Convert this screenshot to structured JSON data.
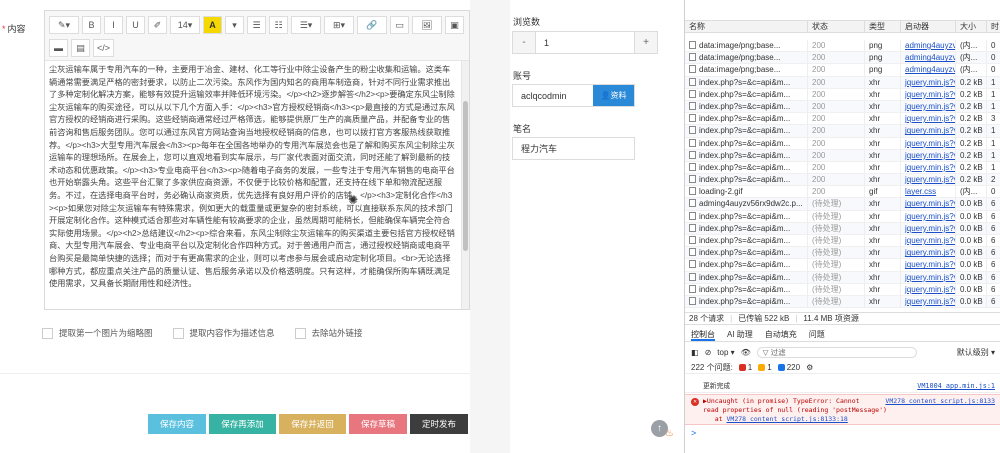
{
  "editor": {
    "field_label": "内容",
    "required_mark": "*",
    "toolbar_row1": [
      "✎▾",
      "B",
      "I",
      "U",
      "✐",
      "14▾",
      "A",
      "▾",
      "☰",
      "☷",
      "☰▾",
      "⊞▾",
      "🔗",
      "▭",
      "🖼",
      "▣"
    ],
    "toolbar_row2": [
      "▬",
      "▤",
      "</>"
    ],
    "content": "尘灰运输车属于专用汽车的一种，主要用于冶金、建材、化工等行业中除尘设备产生的粉尘收集和运输。这类车辆通常需要满足严格的密封要求，以防止二次污染。东风作为国内知名的商用车制造商，针对不同行业需求推出了多种定制化解决方案，能够有效提升运输效率并降低环境污染。</p><h2>逐步解答</h2><p>要确定东风尘制除尘灰运输车的购买途径，可以从以下几个方面入手：</p><h3>官方授权经销商</h3><p>最直接的方式是通过东风官方授权的经销商进行采购。这些经销商通常经过严格筛选，能够提供原厂生产的高质量产品，并配备专业的售前咨询和售后服务团队。您可以通过东风官方网站查询当地授权经销商的信息，也可以拨打官方客服热线获取推荐。</p><h3>大型专用汽车展会</h3><p>每年在全国各地举办的专用汽车展览会也是了解和购买东风尘制除尘灰运输车的理想场所。在展会上，您可以直观地看到实车展示，与厂家代表面对面交流，同时还能了解到最新的技术动态和优惠政策。</p><h3>专业电商平台</h3><p>随着电子商务的发展，一些专注于专用汽车销售的电商平台也开始崭露头角。这些平台汇聚了多家供应商资源，不仅便于比较价格和配置，还支持在线下单和物流配送服务。不过，在选择电商平台时，务必确认商家资质，优先选择有良好用户评价的店铺。</p><h3>定制化合作</h3><p>如果您对除尘灰运输车有特殊需求，例如更大的载重量或更复杂的密封系统，可以直接联系东风的技术部门开展定制化合作。这种模式适合那些对车辆性能有较高要求的企业，虽然周期可能稍长，但能确保车辆完全符合实际使用场景。</p><h2>总结建议</h2><p>综合来看，东风尘制除尘灰运输车的购买渠道主要包括官方授权经销商、大型专用汽车展会、专业电商平台以及定制化合作四种方式。对于普通用户而言，通过授权经销商或电商平台购买是最简单快捷的选择；而对于有更高需求的企业，则可以考虑参与展会或启动定制化项目。<br>无论选择哪种方式，都应重点关注产品的质量认证、售后服务承诺以及价格透明度。只有这样，才能确保所购车辆既满足使用需求，又具备长期耐用性和经济性。"
  },
  "checkboxes": [
    {
      "label": "提取第一个图片为缩略图"
    },
    {
      "label": "提取内容作为描述信息"
    },
    {
      "label": "去除站外链接"
    }
  ],
  "form": {
    "views_label": "浏览数",
    "views_value": "1",
    "minus": "-",
    "plus": "+",
    "account_label": "账号",
    "account_value": "aclqcodmin",
    "profile_button": "资料",
    "note_label": "笔名",
    "note_value": "程力汽车"
  },
  "actions": {
    "save": "保存内容",
    "save_add": "保存再添加",
    "save_back": "保存并返回",
    "save_draft": "保存草稿",
    "schedule": "定时发布"
  },
  "devtools": {
    "columns": [
      "名称",
      "状态",
      "类型",
      "启动器",
      "大小",
      "时"
    ],
    "rows": [
      {
        "name": "data:image/png;base...",
        "status": "200",
        "type": "png",
        "initiator": "adming4auyzv5",
        "size": "(内...",
        "time": "0"
      },
      {
        "name": "data:image/png;base...",
        "status": "200",
        "type": "png",
        "initiator": "adming4auyzv5",
        "size": "(内...",
        "time": "0"
      },
      {
        "name": "data:image/png;base...",
        "status": "200",
        "type": "png",
        "initiator": "adming4auyzv5",
        "size": "(内...",
        "time": "0"
      },
      {
        "name": "index.php?s=&c=api&m...",
        "status": "200",
        "type": "xhr",
        "initiator": "jquery.min.js?v",
        "size": "0.2 kB",
        "time": "1"
      },
      {
        "name": "index.php?s=&c=api&m...",
        "status": "200",
        "type": "xhr",
        "initiator": "jquery.min.js?v",
        "size": "0.2 kB",
        "time": "1"
      },
      {
        "name": "index.php?s=&c=api&m...",
        "status": "200",
        "type": "xhr",
        "initiator": "jquery.min.js?v",
        "size": "0.2 kB",
        "time": "1"
      },
      {
        "name": "index.php?s=&c=api&m...",
        "status": "200",
        "type": "xhr",
        "initiator": "jquery.min.js?v",
        "size": "0.2 kB",
        "time": "3"
      },
      {
        "name": "index.php?s=&c=api&m...",
        "status": "200",
        "type": "xhr",
        "initiator": "jquery.min.js?v",
        "size": "0.2 kB",
        "time": "1"
      },
      {
        "name": "index.php?s=&c=api&m...",
        "status": "200",
        "type": "xhr",
        "initiator": "jquery.min.js?v",
        "size": "0.2 kB",
        "time": "1"
      },
      {
        "name": "index.php?s=&c=api&m...",
        "status": "200",
        "type": "xhr",
        "initiator": "jquery.min.js?v",
        "size": "0.2 kB",
        "time": "1"
      },
      {
        "name": "index.php?s=&c=api&m...",
        "status": "200",
        "type": "xhr",
        "initiator": "jquery.min.js?v",
        "size": "0.2 kB",
        "time": "1"
      },
      {
        "name": "index.php?s=&c=api&m...",
        "status": "200",
        "type": "xhr",
        "initiator": "jquery.min.js?v",
        "size": "0.2 kB",
        "time": "2"
      },
      {
        "name": "loading-2.gif",
        "status": "200",
        "type": "gif",
        "initiator": "layer.css",
        "size": "(内...",
        "time": "0"
      },
      {
        "name": "adming4auyzv56rx9dw2c.p...",
        "status": "(待处理)",
        "type": "xhr",
        "initiator": "jquery.min.js?v",
        "size": "0.0 kB",
        "time": "6"
      },
      {
        "name": "index.php?s=&c=api&m...",
        "status": "(待处理)",
        "type": "xhr",
        "initiator": "jquery.min.js?v",
        "size": "0.0 kB",
        "time": "6"
      },
      {
        "name": "index.php?s=&c=api&m...",
        "status": "(待处理)",
        "type": "xhr",
        "initiator": "jquery.min.js?v",
        "size": "0.0 kB",
        "time": "6"
      },
      {
        "name": "index.php?s=&c=api&m...",
        "status": "(待处理)",
        "type": "xhr",
        "initiator": "jquery.min.js?v",
        "size": "0.0 kB",
        "time": "6"
      },
      {
        "name": "index.php?s=&c=api&m...",
        "status": "(待处理)",
        "type": "xhr",
        "initiator": "jquery.min.js?v",
        "size": "0.0 kB",
        "time": "6"
      },
      {
        "name": "index.php?s=&c=api&m...",
        "status": "(待处理)",
        "type": "xhr",
        "initiator": "jquery.min.js?v",
        "size": "0.0 kB",
        "time": "6"
      },
      {
        "name": "index.php?s=&c=api&m...",
        "status": "(待处理)",
        "type": "xhr",
        "initiator": "jquery.min.js?v",
        "size": "0.0 kB",
        "time": "6"
      },
      {
        "name": "index.php?s=&c=api&m...",
        "status": "(待处理)",
        "type": "xhr",
        "initiator": "jquery.min.js?v",
        "size": "0.0 kB",
        "time": "6"
      },
      {
        "name": "index.php?s=&c=api&m...",
        "status": "(待处理)",
        "type": "xhr",
        "initiator": "jquery.min.js?v",
        "size": "0.0 kB",
        "time": "6"
      }
    ],
    "summary": {
      "requests": "28 个请求",
      "transferred": "已传输 522 kB",
      "resources": "11.4 MB 项资源"
    },
    "console_tabs": [
      "控制台",
      "AI 助理",
      "自动填充",
      "问题"
    ],
    "context": "top",
    "filter_placeholder": "过滤",
    "level": "默认级别",
    "issues": {
      "label": "222 个问题:",
      "error": "1",
      "warning": "1",
      "info": "220"
    },
    "log_text": "更新完成",
    "log_src": "VM1004 app.min.js:1",
    "error_line1": "▶Uncaught (in promise) TypeError: Cannot",
    "error_src": "VM278 content script.js:8133",
    "error_line2": "read properties of null (reading 'postMessage')",
    "error_line3_prefix": "at",
    "error_line3_link": "VM278 content script.js:8133:18",
    "prompt": ">"
  }
}
